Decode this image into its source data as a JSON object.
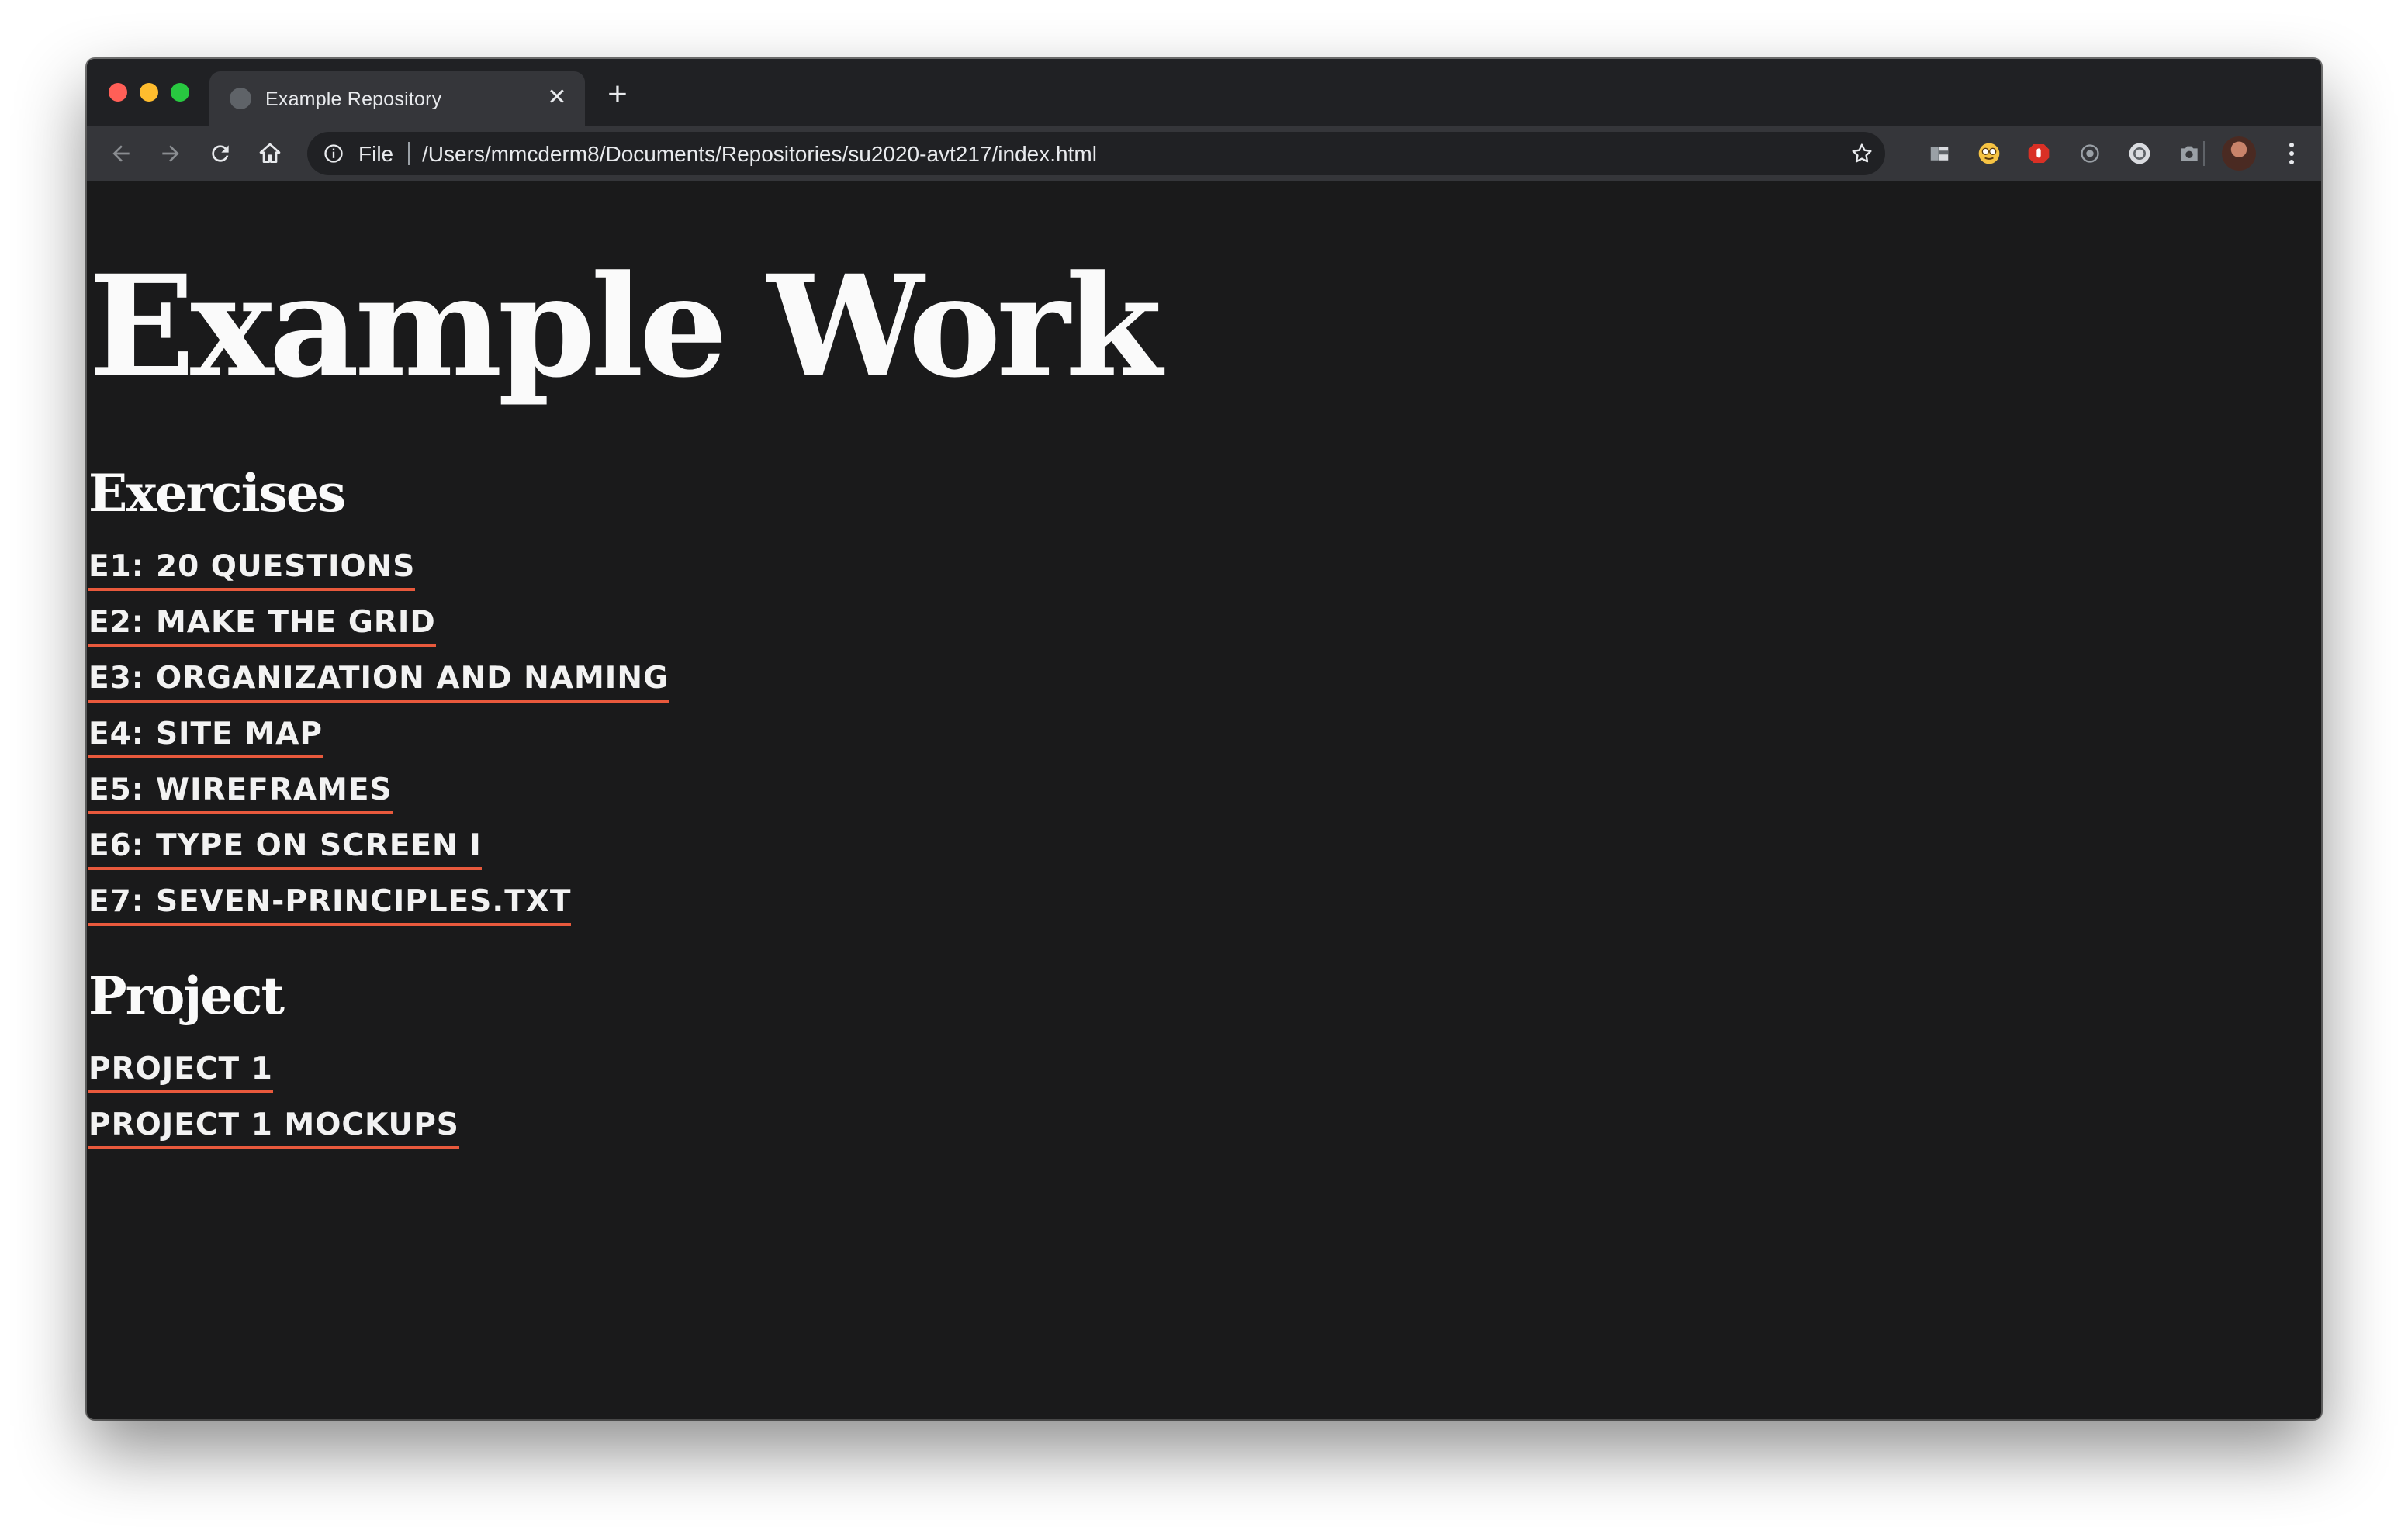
{
  "browser": {
    "tab_title": "Example Repository",
    "tab_close": "✕",
    "new_tab": "+",
    "address_scheme": "File",
    "address_url": "/Users/mmcderm8/Documents/Repositories/su2020-avt217/index.html",
    "icons": [
      "back-icon",
      "forward-icon",
      "reload-icon",
      "home-icon",
      "info-icon",
      "bookmark-star-icon",
      "extension-icons",
      "profile-avatar",
      "menu-icon"
    ]
  },
  "page": {
    "title": "Example Work",
    "exercises": {
      "heading": "Exercises",
      "links": [
        "E1: 20 QUESTIONS",
        "E2: MAKE THE GRID",
        "E3: ORGANIZATION AND NAMING",
        "E4: SITE MAP",
        "E5: WIREFRAMES",
        "E6: TYPE ON SCREEN I",
        "E7: SEVEN-PRINCIPLES.TXT"
      ]
    },
    "project": {
      "heading": "Project",
      "links": [
        "PROJECT 1",
        "PROJECT 1 MOCKUPS"
      ]
    },
    "colors": {
      "background": "#1a1a1b",
      "text": "#fafafa",
      "link_underline": "#e8593c"
    }
  }
}
